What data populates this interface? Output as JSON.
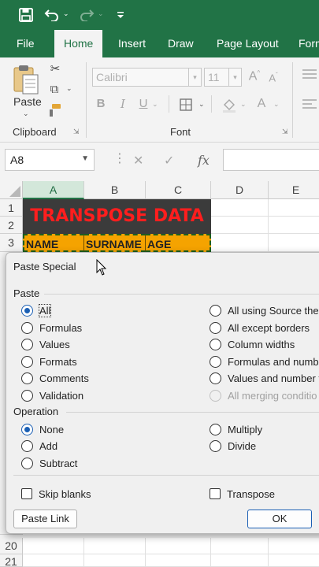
{
  "quick_access": {
    "save_icon": "save-icon",
    "undo_icon": "undo-icon",
    "redo_icon": "redo-icon",
    "customize_icon": "customize-quick-access-icon"
  },
  "tabs": [
    "File",
    "Home",
    "Insert",
    "Draw",
    "Page Layout",
    "Form"
  ],
  "ribbon": {
    "paste_label": "Paste",
    "clipboard_label": "Clipboard",
    "font_label": "Font",
    "font_name": "Calibri",
    "font_size": "11",
    "bold": "B",
    "italic": "I",
    "underline": "U"
  },
  "formula_bar": {
    "name_box": "A8",
    "fx": "fx",
    "value": ""
  },
  "grid": {
    "columns": [
      "A",
      "B",
      "C",
      "D",
      "E"
    ],
    "rows": [
      "1",
      "2",
      "3",
      "20",
      "21"
    ],
    "title": "TRANSPOSE DATA",
    "headers": [
      "NAME",
      "SURNAME",
      "AGE"
    ]
  },
  "dialog": {
    "title": "Paste Special",
    "paste_section": "Paste",
    "paste_left": [
      "All",
      "Formulas",
      "Values",
      "Formats",
      "Comments",
      "Validation"
    ],
    "paste_right": [
      "All using Source the",
      "All except borders",
      "Column widths",
      "Formulas and numb",
      "Values and number f",
      "All merging conditio"
    ],
    "operation_section": "Operation",
    "op_left": [
      "None",
      "Add",
      "Subtract"
    ],
    "op_right": [
      "Multiply",
      "Divide"
    ],
    "skip_blanks": "Skip blanks",
    "transpose": "Transpose",
    "paste_link": "Paste Link",
    "ok": "OK"
  },
  "colors": {
    "excel_green": "#217346",
    "title_red": "#ff1e1e",
    "header_orange": "#f5a300",
    "radio_blue": "#1a5fb4"
  }
}
